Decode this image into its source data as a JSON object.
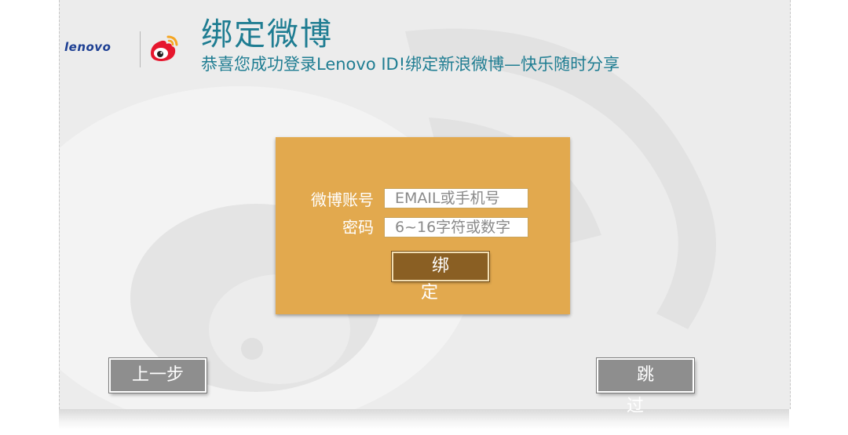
{
  "header": {
    "lenovo_logo_text": "lenovo",
    "weibo_logo_icon": "weibo-eye-icon",
    "title": "绑定微博",
    "subtitle": "恭喜您成功登录Lenovo ID!绑定新浪微博—快乐随时分享"
  },
  "form": {
    "account_label": "微博账号",
    "account_placeholder": "EMAIL或手机号",
    "password_label": "密码",
    "password_placeholder": "6~16字符或数字",
    "bind_button_label": "绑定"
  },
  "footer": {
    "prev_button_label": "上一步",
    "skip_button_label": "跳过"
  },
  "colors": {
    "title": "#1f7d92",
    "card": "#e2a94e",
    "bind_button": "#8a5f23",
    "nav_button": "#8e8e8e",
    "weibo_red": "#e6162d",
    "weibo_orange": "#f5a623",
    "lenovo_blue": "#1d3f93"
  }
}
